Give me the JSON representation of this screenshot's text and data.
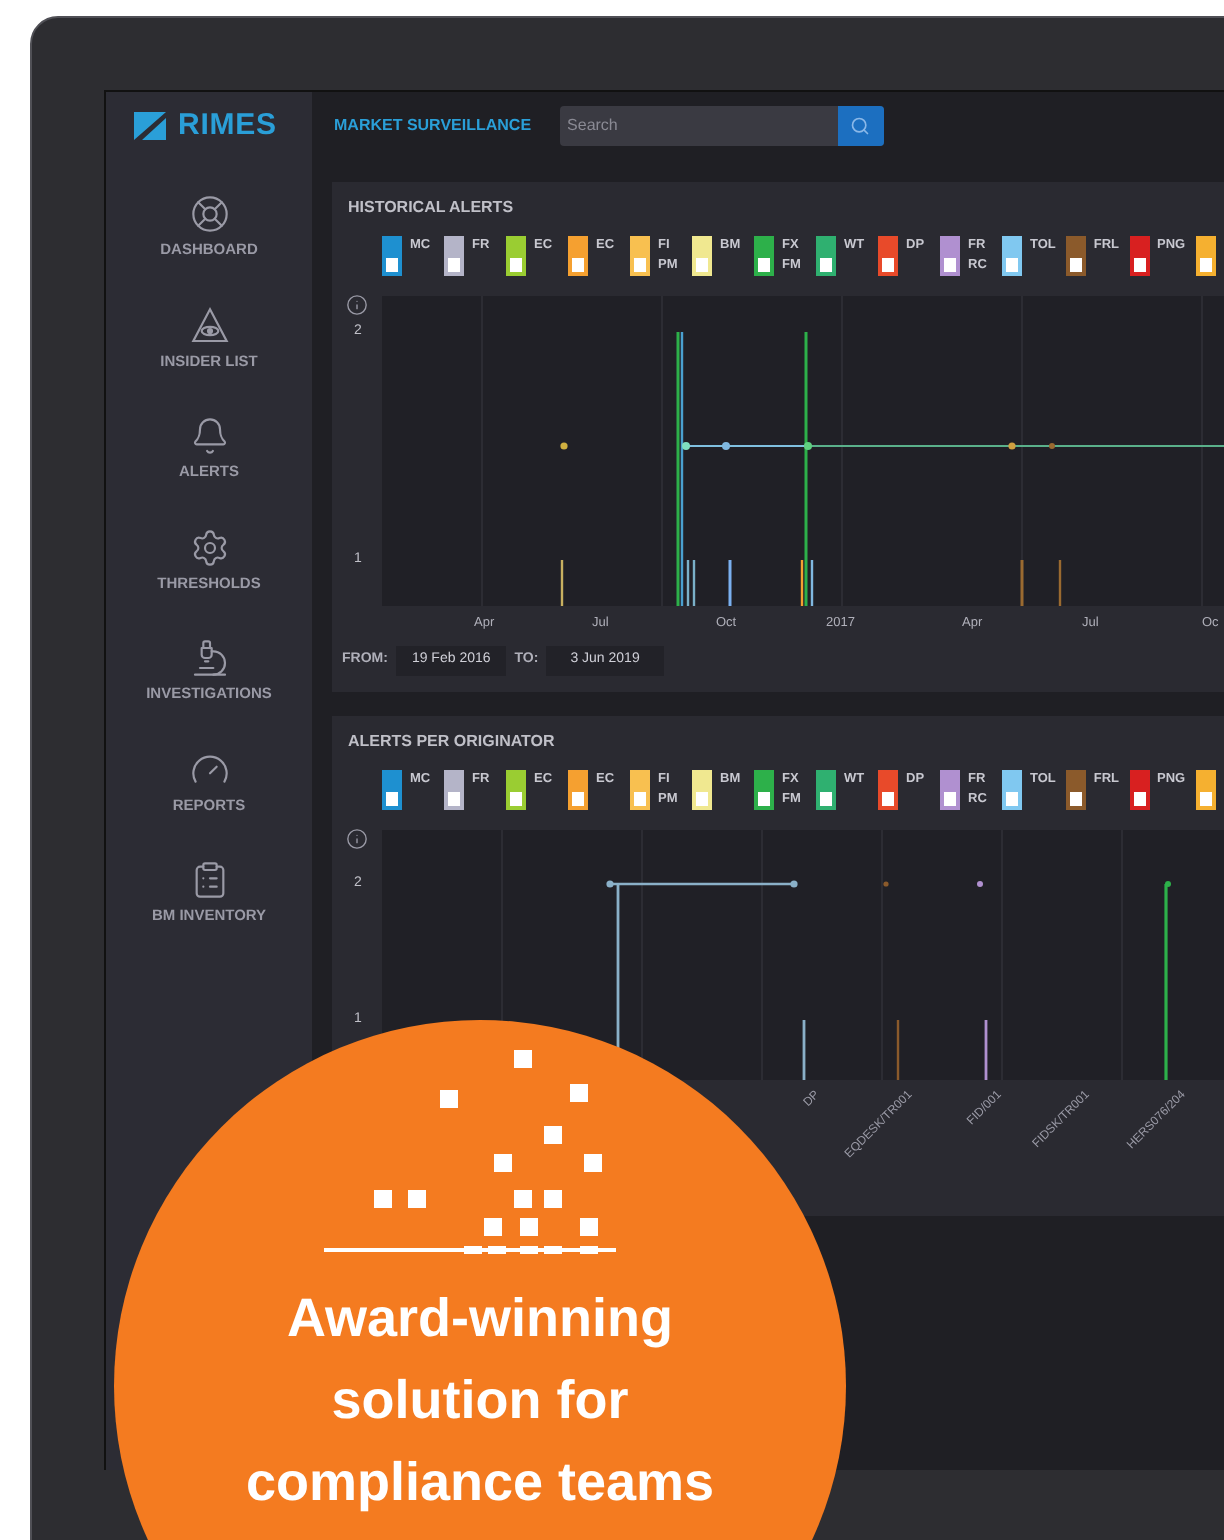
{
  "brand": {
    "name": "RIMES"
  },
  "top_bar": {
    "title": "MARKET SURVEILLANCE",
    "search": {
      "placeholder": "Search"
    }
  },
  "sidebar": {
    "items": [
      {
        "label": "DASHBOARD",
        "selected": false
      },
      {
        "label": "INSIDER LIST",
        "selected": false
      },
      {
        "label": "ALERTS",
        "selected": false
      },
      {
        "label": "THRESHOLDS",
        "selected": false
      },
      {
        "label": "INVESTIGATIONS",
        "selected": false
      },
      {
        "label": "REPORTS",
        "selected": false
      },
      {
        "label": "BM INVENTORY",
        "selected": false
      }
    ]
  },
  "panels": [
    {
      "kind": "timeline",
      "title": "HISTORICAL ALERTS",
      "legend": [
        {
          "label": "MC",
          "color": "#1e90d0"
        },
        {
          "label": "FR",
          "color": "#b4b4c8"
        },
        {
          "label": "EC",
          "color": "#9acd32"
        },
        {
          "label": "EC",
          "color": "#f5a030"
        },
        {
          "label": "FI\nPM",
          "color": "#f8c050"
        },
        {
          "label": "BM",
          "color": "#f0e890"
        },
        {
          "label": "FX\nFM",
          "color": "#2db04a"
        },
        {
          "label": "WT",
          "color": "#2fb070"
        },
        {
          "label": "DP",
          "color": "#e84a2a"
        },
        {
          "label": "FR\nRC",
          "color": "#b090d0"
        },
        {
          "label": "TOL",
          "color": "#80c8f0"
        },
        {
          "label": "FRL",
          "color": "#8b5a2b"
        },
        {
          "label": "PNG",
          "color": "#d82020"
        },
        {
          "color": "#f5b030"
        }
      ],
      "y_labels": [
        "2",
        "1"
      ],
      "x_labels": [
        "Apr",
        "Jul",
        "Oct",
        "2017",
        "Apr",
        "Jul",
        "Oc"
      ],
      "range": {
        "from_label": "FROM:",
        "from": "19 Feb 2016",
        "to_label": "TO:",
        "to": "3 Jun 2019"
      }
    },
    {
      "kind": "originator",
      "title": "ALERTS PER ORIGINATOR",
      "legend": [
        {
          "label": "MC",
          "color": "#1e90d0"
        },
        {
          "label": "FR",
          "color": "#b4b4c8"
        },
        {
          "label": "EC",
          "color": "#9acd32"
        },
        {
          "label": "EC",
          "color": "#f5a030"
        },
        {
          "label": "FI\nPM",
          "color": "#f8c050"
        },
        {
          "label": "BM",
          "color": "#f0e890"
        },
        {
          "label": "FX\nFM",
          "color": "#2db04a"
        },
        {
          "label": "WT",
          "color": "#2fb070"
        },
        {
          "label": "DP",
          "color": "#e84a2a"
        },
        {
          "label": "FR\nRC",
          "color": "#b090d0"
        },
        {
          "label": "TOL",
          "color": "#80c8f0"
        },
        {
          "label": "FRL",
          "color": "#8b5a2b"
        },
        {
          "label": "PNG",
          "color": "#d82020"
        },
        {
          "color": "#f5b030"
        }
      ],
      "y_labels": [
        "2",
        "1"
      ],
      "x_labels": [
        "DP",
        "EQDESK/TR001",
        "FID/001",
        "FIDSK/TR001",
        "HERS076/204"
      ]
    }
  ],
  "badge": {
    "text": "Award-winning solution for compliance teams"
  }
}
